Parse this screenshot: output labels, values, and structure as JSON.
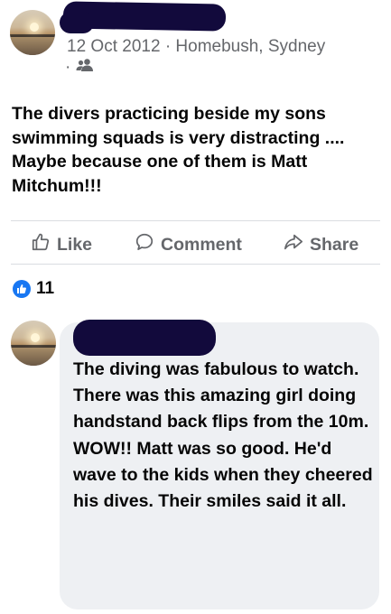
{
  "post": {
    "date": "12 Oct 2012",
    "separator": "·",
    "location": "Homebush, Sydney",
    "audience_dot": "·",
    "audience_icon": "friends-icon",
    "text": "The divers practicing beside my sons swimming squads is very distracting .... Maybe because one of them is Matt Mitchum!!!"
  },
  "actions": {
    "like_label": "Like",
    "comment_label": "Comment",
    "share_label": "Share"
  },
  "reactions": {
    "count": "11",
    "icon": "thumbs-up-icon"
  },
  "comment": {
    "text": "The diving was fabulous to watch. There was this amazing girl doing handstand back flips from the 10m. WOW!!  Matt was so good. He'd wave to the kids when they cheered his dives. Their smiles said it all."
  },
  "colors": {
    "accent": "#1877f2",
    "secondary_text": "#65676b",
    "redaction": "#120a3c",
    "bubble": "#eef0f3"
  }
}
